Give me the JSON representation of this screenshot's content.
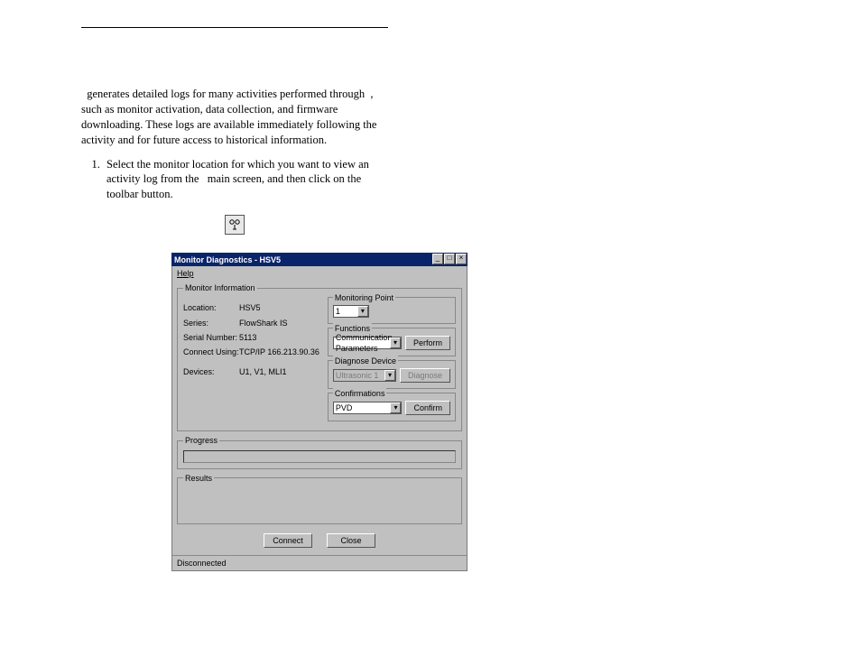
{
  "para": {
    "p1a": "generates detailed logs for many activities performed through",
    "p1b": ", such as monitor activation, data collection, and firmware downloading. These logs are available immediately following the activity and for future access to historical information."
  },
  "step": {
    "num": "1.",
    "a": "Select the monitor location for which you want to view an activity log from the",
    "b": "main screen, and then click on the",
    "c": "toolbar button."
  },
  "window": {
    "title": "Monitor Diagnostics - HSV5",
    "menu_help": "Help",
    "gb_monitor_info": "Monitor Information",
    "info": {
      "location_k": "Location:",
      "location_v": "HSV5",
      "series_k": "Series:",
      "series_v": "FlowShark IS",
      "serial_k": "Serial Number:",
      "serial_v": "5113",
      "connect_k": "Connect Using:",
      "connect_v": "TCP/IP 166.213.90.36",
      "devices_k": "Devices:",
      "devices_v": "U1, V1, MLI1"
    },
    "mp": {
      "title": "Monitoring Point",
      "value": "1"
    },
    "funcs": {
      "title": "Functions",
      "value": "Communication Parameters",
      "perform": "Perform"
    },
    "diag": {
      "title": "Diagnose Device",
      "value": "Ultrasonic 1",
      "diagnose": "Diagnose"
    },
    "conf": {
      "title": "Confirmations",
      "value": "PVD",
      "confirm": "Confirm"
    },
    "progress": "Progress",
    "results": "Results",
    "connect": "Connect",
    "close": "Close",
    "status": "Disconnected"
  }
}
